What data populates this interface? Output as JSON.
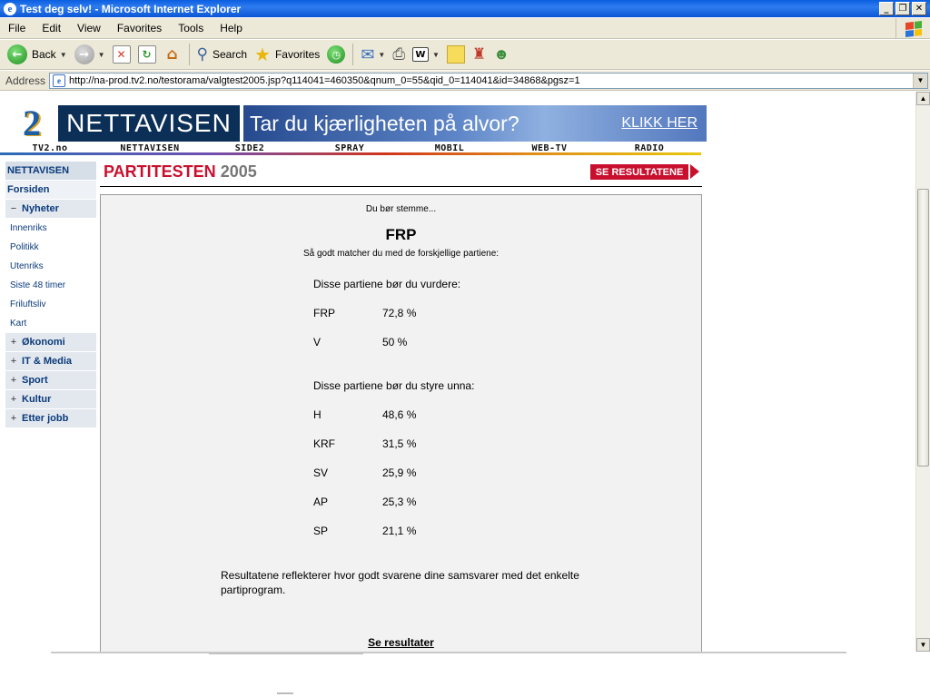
{
  "window": {
    "title": "Test deg selv! - Microsoft Internet Explorer"
  },
  "menu": [
    "File",
    "Edit",
    "View",
    "Favorites",
    "Tools",
    "Help"
  ],
  "toolbar": {
    "back": "Back",
    "search": "Search",
    "favorites": "Favorites"
  },
  "address": {
    "label": "Address",
    "url": "http://na-prod.tv2.no/testorama/valgtest2005.jsp?q114041=460350&qnum_0=55&qid_0=114041&id=34868&pgsz=1"
  },
  "banner": {
    "nettavisen": "NETTAVISEN",
    "ad_text": "Tar du kjærligheten på alvor?",
    "ad_link": "KLIKK HER"
  },
  "topnav": [
    "TV2.no",
    "NETTAVISEN",
    "SIDE2",
    "SPRAY",
    "MOBIL",
    "WEB-TV",
    "RADIO"
  ],
  "leftnav": {
    "header": "NETTAVISEN",
    "frontpage": "Forsiden",
    "nyheter": {
      "toggle": "−",
      "label": "Nyheter"
    },
    "nyheter_items": [
      "Innenriks",
      "Politikk",
      "Utenriks",
      "Siste 48 timer",
      "Friluftsliv",
      "Kart"
    ],
    "sections": [
      {
        "toggle": "+",
        "label": "Økonomi"
      },
      {
        "toggle": "+",
        "label": "IT & Media"
      },
      {
        "toggle": "+",
        "label": "Sport"
      },
      {
        "toggle": "+",
        "label": "Kultur"
      },
      {
        "toggle": "+",
        "label": "Etter jobb"
      }
    ]
  },
  "partitest": {
    "title": "PARTITESTEN",
    "year": "2005",
    "results_button": "SE RESULTATENE"
  },
  "result": {
    "intro": "Du bør stemme...",
    "party": "FRP",
    "match_text": "Så godt matcher du med de forskjellige partiene:",
    "consider_heading": "Disse partiene bør du vurdere:",
    "consider": [
      {
        "party": "FRP",
        "score": "72,8 %"
      },
      {
        "party": "V",
        "score": "50 %"
      }
    ],
    "avoid_heading": "Disse partiene bør du styre unna:",
    "avoid": [
      {
        "party": "H",
        "score": "48,6 %"
      },
      {
        "party": "KRF",
        "score": "31,5 %"
      },
      {
        "party": "SV",
        "score": "25,9 %"
      },
      {
        "party": "AP",
        "score": "25,3 %"
      },
      {
        "party": "SP",
        "score": "21,1 %"
      }
    ],
    "note": "Resultatene reflekterer hvor godt svarene dine samsvarer med det enkelte partiprogram.",
    "link": "Se resultater"
  }
}
